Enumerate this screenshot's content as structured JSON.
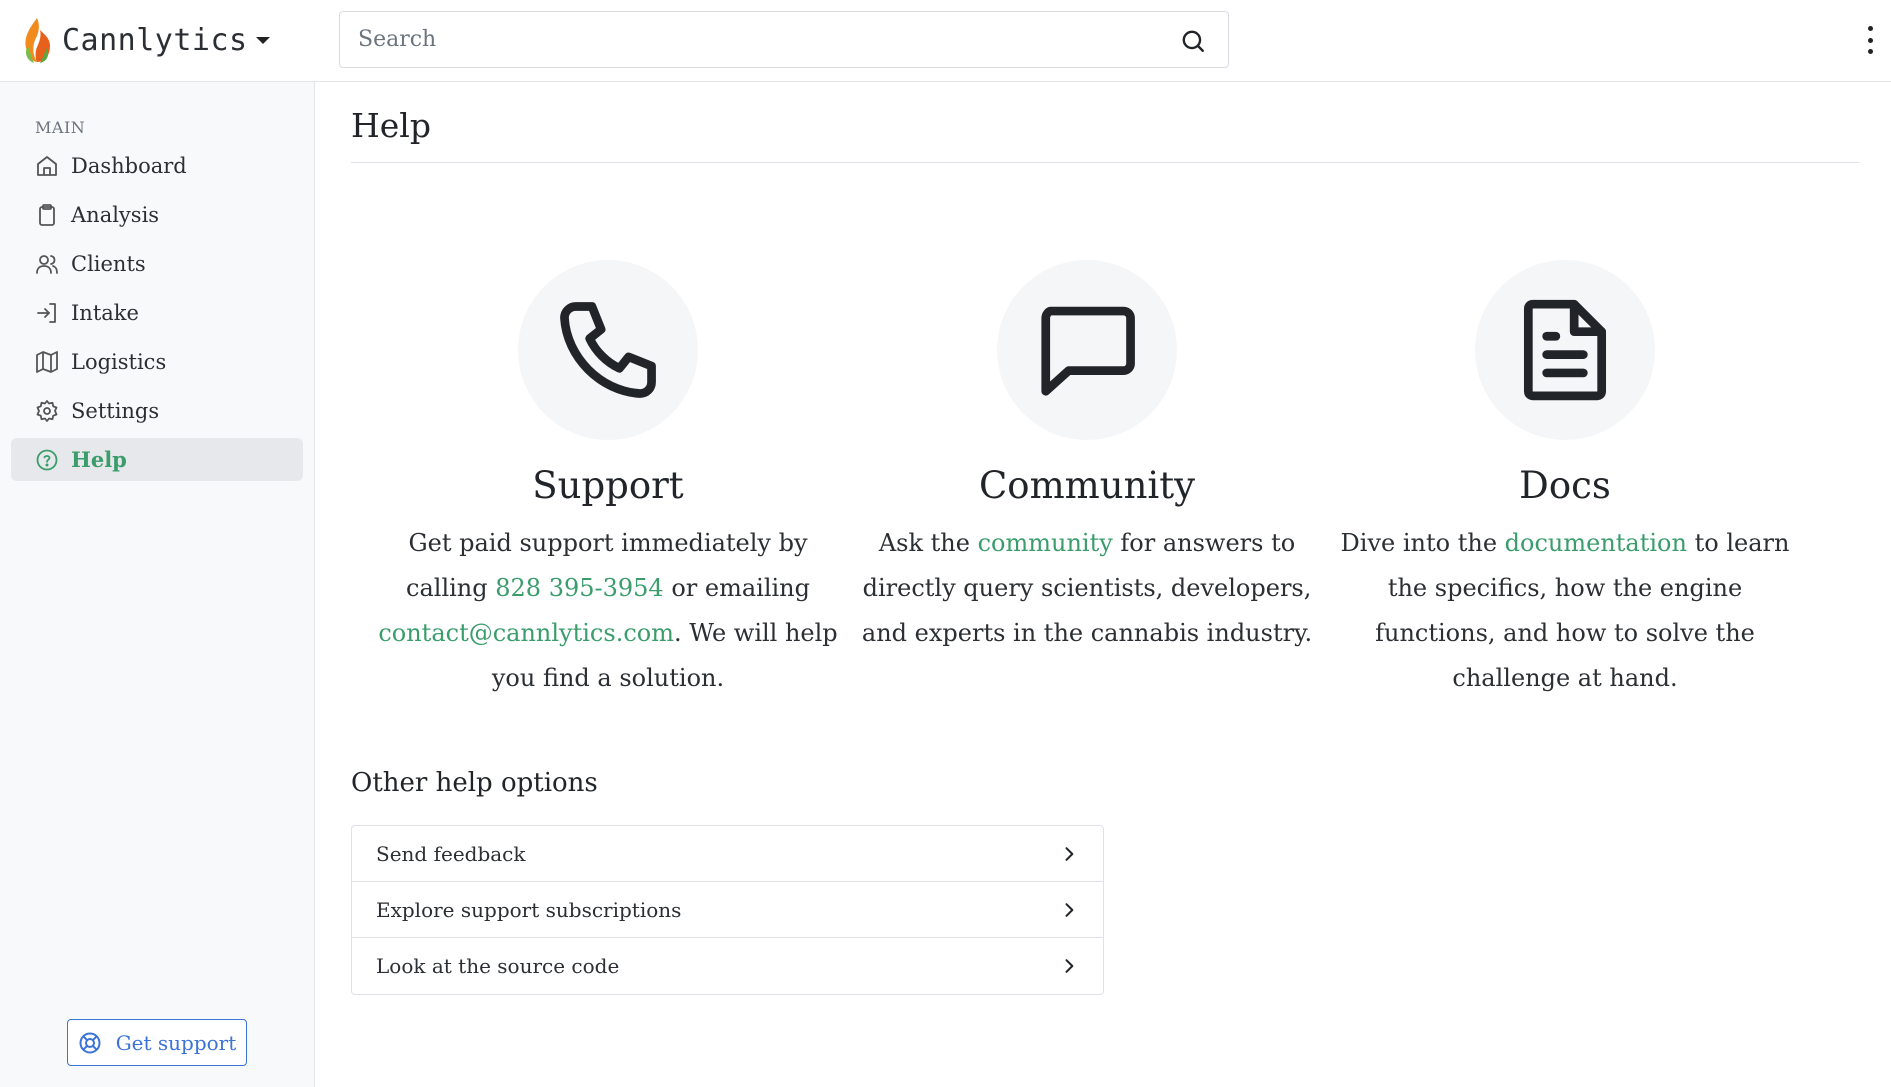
{
  "brand": {
    "name": "Cannlytics"
  },
  "search": {
    "placeholder": "Search"
  },
  "sidebar": {
    "heading": "MAIN",
    "items": [
      {
        "label": "Dashboard",
        "icon": "home-icon"
      },
      {
        "label": "Analysis",
        "icon": "clipboard-icon"
      },
      {
        "label": "Clients",
        "icon": "users-icon"
      },
      {
        "label": "Intake",
        "icon": "log-in-icon"
      },
      {
        "label": "Logistics",
        "icon": "map-icon"
      },
      {
        "label": "Settings",
        "icon": "gear-icon"
      },
      {
        "label": "Help",
        "icon": "help-circle-icon",
        "active": true
      }
    ],
    "get_support": "Get support"
  },
  "main": {
    "title": "Help",
    "cards": [
      {
        "title": "Support",
        "icon": "phone-icon",
        "text_1": "Get paid support immediately by calling ",
        "link_1": "828 395-3954",
        "text_2": " or emailing ",
        "link_2": "contact@cannlytics.com",
        "text_3": ". We will help you find a solution."
      },
      {
        "title": "Community",
        "icon": "message-square-icon",
        "text_1": "Ask the ",
        "link_1": "community",
        "text_2": " for answers to directly query scientists, developers, and experts in the cannabis industry."
      },
      {
        "title": "Docs",
        "icon": "file-text-icon",
        "text_1": "Dive into the ",
        "link_1": "documentation",
        "text_2": " to learn the specifics, how the engine functions, and how to solve the challenge at hand."
      }
    ],
    "other_title": "Other help options",
    "options": [
      {
        "label": "Send feedback"
      },
      {
        "label": "Explore support subscriptions"
      },
      {
        "label": "Look at the source code"
      }
    ]
  },
  "colors": {
    "accent_green": "#3a9d6b",
    "support_blue": "#3b73d9",
    "sidebar_bg": "#f8f9fa"
  }
}
